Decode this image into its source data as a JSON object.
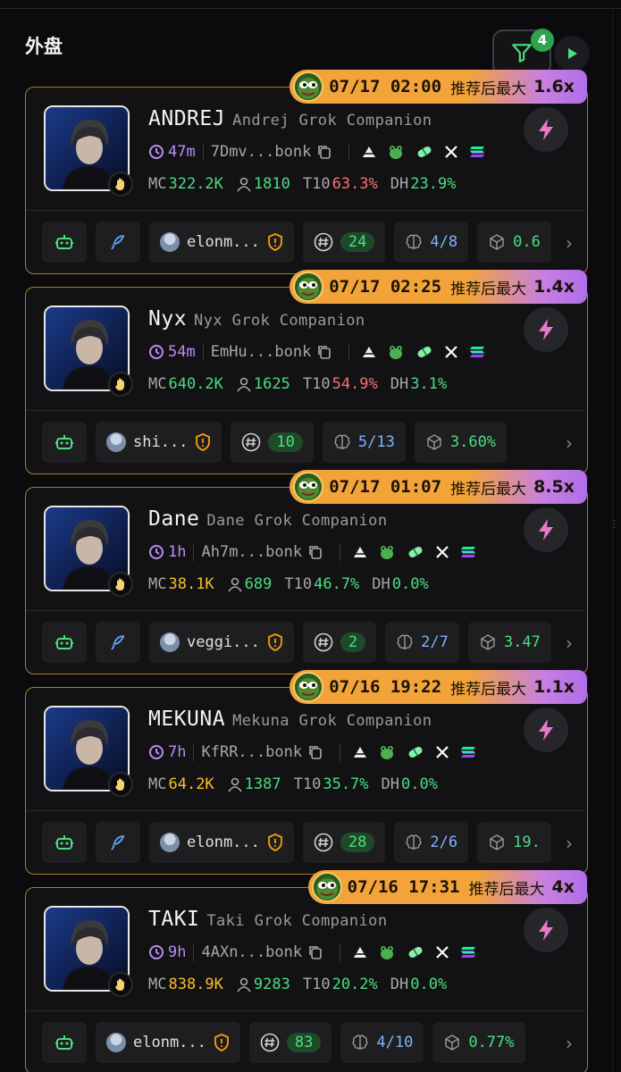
{
  "header": {
    "title": "外盘",
    "filter_count": "4"
  },
  "cards": [
    {
      "time": "07/17 02:00",
      "rec_label": "推荐后最大",
      "mult": "1.6x",
      "name": "ANDREJ",
      "sub": "Andrej Grok Companion",
      "age": "47m",
      "addr": "7Dmv...bonk",
      "mc": "322.2K",
      "holders": "1810",
      "t10": "63.3%",
      "dh": "23.9%",
      "twitter_icon": "feather-icon",
      "user": "elonm...",
      "replies": "24",
      "brain": "4/8",
      "box": "0.6",
      "t10_color": "red",
      "mc_color": "green",
      "dh_color": "green"
    },
    {
      "time": "07/17 02:25",
      "rec_label": "推荐后最大",
      "mult": "1.4x",
      "name": "Nyx",
      "sub": "Nyx Grok Companion",
      "age": "54m",
      "addr": "EmHu...bonk",
      "mc": "640.2K",
      "holders": "1625",
      "t10": "54.9%",
      "dh": "3.1%",
      "twitter_icon": "",
      "user": "shi...",
      "replies": "10",
      "brain": "5/13",
      "box": "3.60%",
      "t10_color": "red",
      "mc_color": "green",
      "dh_color": "green"
    },
    {
      "time": "07/17 01:07",
      "rec_label": "推荐后最大",
      "mult": "8.5x",
      "name": "Dane",
      "sub": "Dane Grok Companion",
      "age": "1h",
      "addr": "Ah7m...bonk",
      "mc": "38.1K",
      "holders": "689",
      "t10": "46.7%",
      "dh": "0.0%",
      "twitter_icon": "feather-icon",
      "user": "veggi...",
      "replies": "2",
      "brain": "2/7",
      "box": "3.47",
      "t10_color": "green",
      "mc_color": "orange",
      "dh_color": "green"
    },
    {
      "time": "07/16 19:22",
      "rec_label": "推荐后最大",
      "mult": "1.1x",
      "name": "MEKUNA",
      "sub": "Mekuna Grok Companion",
      "age": "7h",
      "addr": "KfRR...bonk",
      "mc": "64.2K",
      "holders": "1387",
      "t10": "35.7%",
      "dh": "0.0%",
      "twitter_icon": "feather-icon",
      "user": "elonm...",
      "replies": "28",
      "brain": "2/6",
      "box": "19.",
      "t10_color": "green",
      "mc_color": "orange",
      "dh_color": "green"
    },
    {
      "time": "07/16 17:31",
      "rec_label": "推荐后最大",
      "mult": "4x",
      "name": "TAKI",
      "sub": "Taki Grok Companion",
      "age": "9h",
      "addr": "4AXn...bonk",
      "mc": "838.9K",
      "holders": "9283",
      "t10": "20.2%",
      "dh": "0.0%",
      "twitter_icon": "",
      "user": "elonm...",
      "replies": "83",
      "brain": "4/10",
      "box": "0.77%",
      "t10_color": "green",
      "mc_color": "orange",
      "dh_color": "green"
    }
  ],
  "labels": {
    "mc": "MC",
    "t10": "T10",
    "dh": "DH"
  },
  "colors": {
    "card_border": "#a57d2c",
    "green": "#4ade80",
    "red": "#f87171",
    "orange": "#fbbf24",
    "purple": "#b98cf2"
  }
}
